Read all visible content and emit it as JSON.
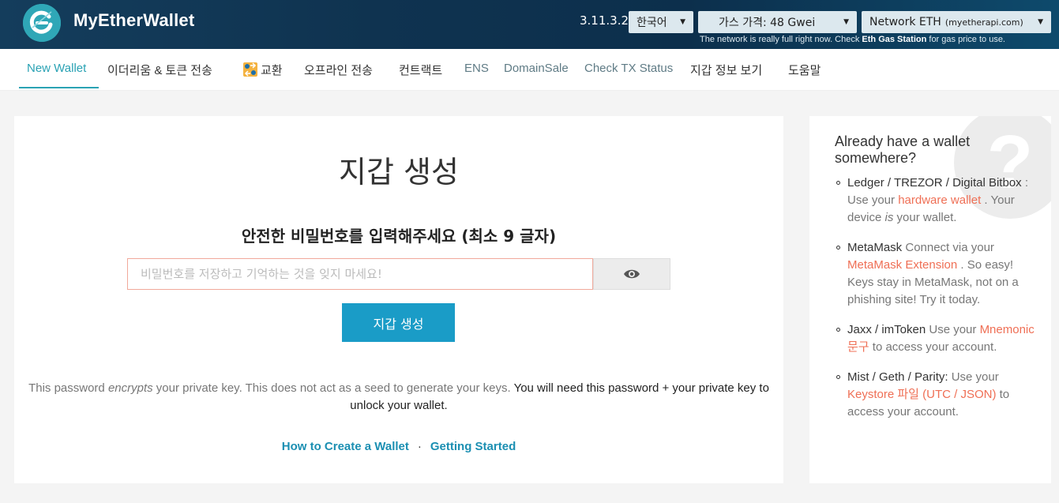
{
  "header": {
    "logo_text": "MyEtherWallet",
    "version": "3.11.3.2",
    "language": "한국어",
    "gas_price": "가스 가격: 48 Gwei",
    "network": "Network ETH",
    "network_api": "(myetherapi.com)",
    "notice_pre": "The network is really full right now. Check ",
    "notice_link": "Eth Gas Station",
    "notice_post": " for gas price to use."
  },
  "nav": {
    "items": [
      "New Wallet",
      "이더리움 & 토큰 전송",
      "교환",
      "오프라인 전송",
      "컨트랙트",
      "ENS",
      "DomainSale",
      "Check TX Status",
      "지갑 정보 보기",
      "도움말"
    ]
  },
  "main": {
    "title": "지갑 생성",
    "subtitle": "안전한 비밀번호를 입력해주세요 (최소 9 글자)",
    "password_placeholder": "비밀번호를 저장하고 기억하는 것을 잊지 마세요!",
    "password_value": "",
    "create_button": "지갑 생성",
    "desc_pre": "This password ",
    "desc_em": "encrypts",
    "desc_mid": " your private key. This does not act as a seed to generate your keys. ",
    "desc_strong": "You will need this password + your private key to unlock your wallet.",
    "link_how": "How to Create a Wallet",
    "link_sep": "·",
    "link_started": "Getting Started"
  },
  "sidebar": {
    "title": "Already have a wallet somewhere?",
    "question_mark": "?",
    "item1_hd": "Ledger / TREZOR / Digital Bitbox",
    "item1_t1": " : Use your ",
    "item1_lnk": "hardware wallet",
    "item1_t2": " . Your device ",
    "item1_em": "is",
    "item1_t3": " your wallet.",
    "item2_hd": "MetaMask",
    "item2_t1": " Connect via your ",
    "item2_lnk": "MetaMask Extension",
    "item2_t2": " . So easy! Keys stay in MetaMask, not on a phishing site! Try it today.",
    "item3_hd": "Jaxx / imToken",
    "item3_t1": " Use your ",
    "item3_lnk": "Mnemonic 문구",
    "item3_t2": " to access your account.",
    "item4_hd": "Mist / Geth / Parity:",
    "item4_t1": " Use your ",
    "item4_lnk": "Keystore 파일 (UTC / JSON)",
    "item4_t2": " to access your account."
  },
  "colors": {
    "accent": "#2aa2b4",
    "button": "#1a9cc7",
    "link_red": "#ef6f55",
    "header_dark": "#0f3350"
  }
}
